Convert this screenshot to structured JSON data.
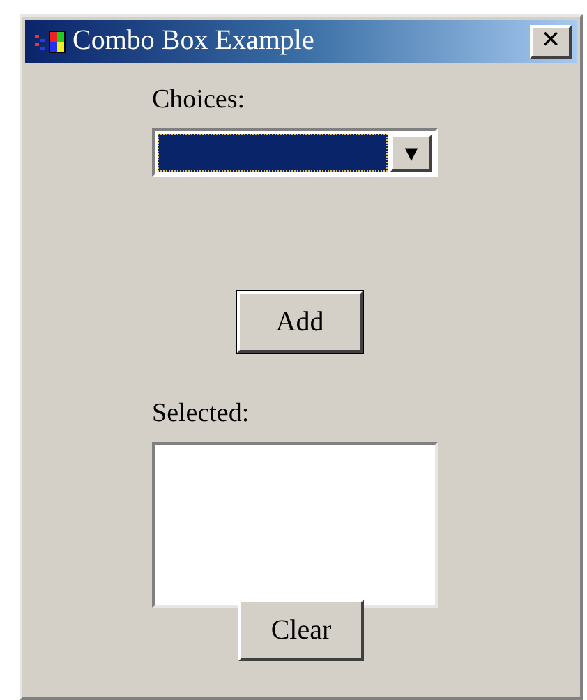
{
  "window": {
    "title": "Combo Box Example",
    "close": "✕"
  },
  "choices": {
    "label": "Choices:",
    "focused": true,
    "arrow": "▼"
  },
  "add_button": "Add",
  "selected": {
    "label": "Selected:"
  },
  "clear_button": "Clear"
}
